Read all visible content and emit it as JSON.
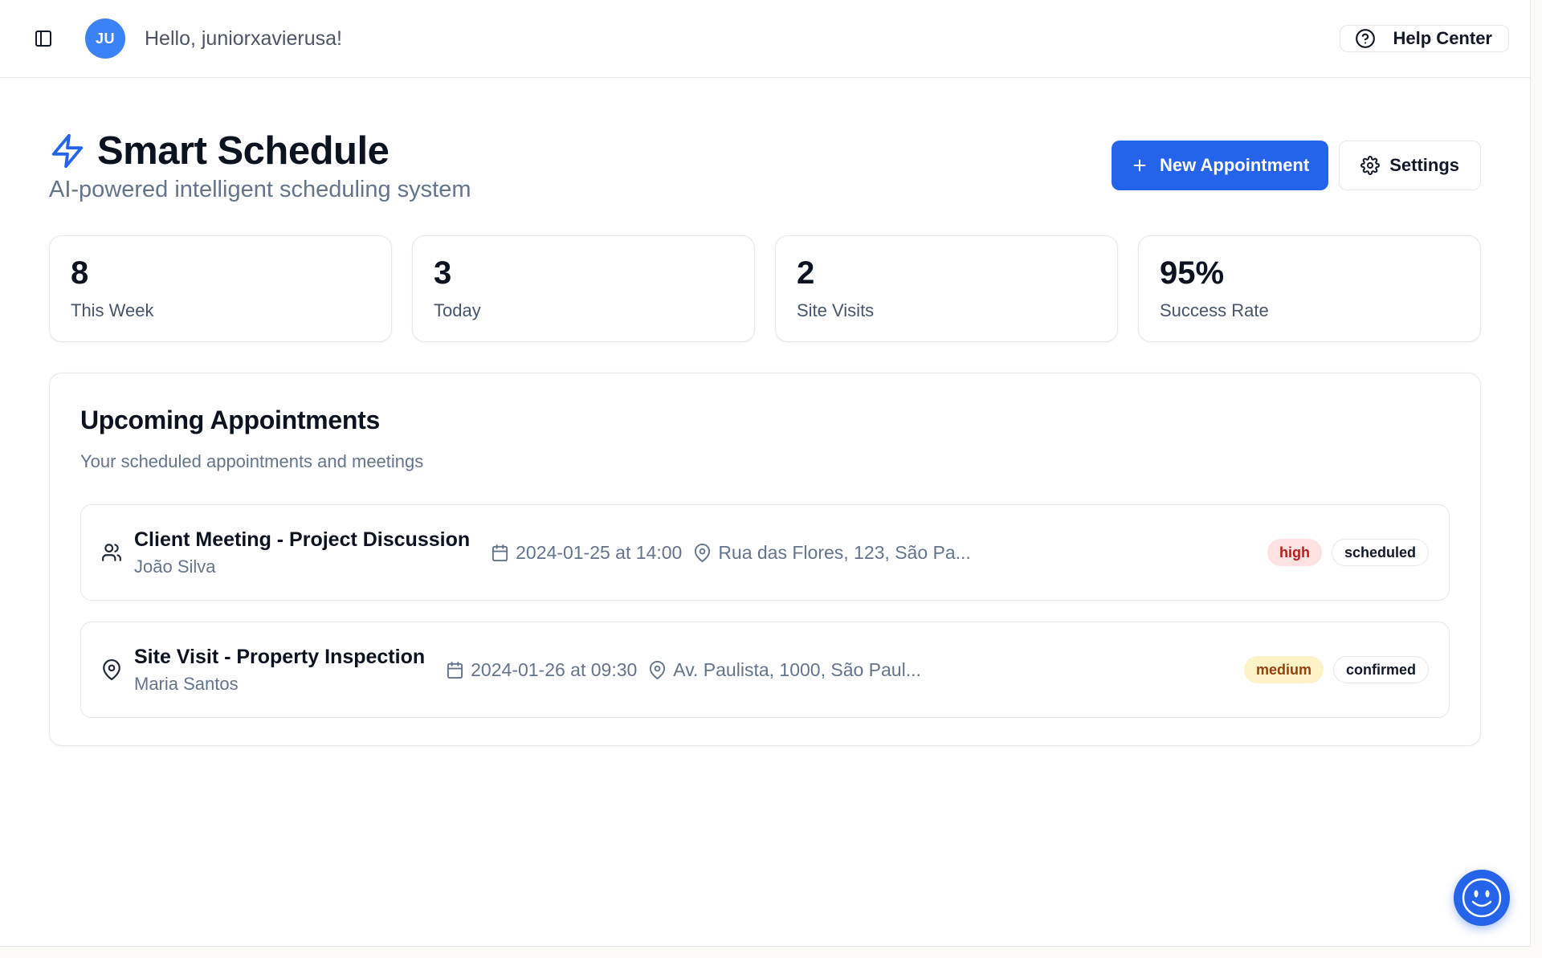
{
  "topbar": {
    "avatar_initials": "JU",
    "greeting": "Hello, juniorxavierusa!",
    "help_label": "Help Center"
  },
  "header": {
    "title": "Smart Schedule",
    "subtitle": "AI-powered intelligent scheduling system",
    "new_appointment_label": "New Appointment",
    "settings_label": "Settings",
    "accent_color": "#2563eb"
  },
  "stats": [
    {
      "value": "8",
      "label": "This Week"
    },
    {
      "value": "3",
      "label": "Today"
    },
    {
      "value": "2",
      "label": "Site Visits"
    },
    {
      "value": "95%",
      "label": "Success Rate"
    }
  ],
  "appointments": {
    "title": "Upcoming Appointments",
    "subtitle": "Your scheduled appointments and meetings",
    "items": [
      {
        "icon": "users-icon",
        "title": "Client Meeting - Project Discussion",
        "person": "João Silva",
        "datetime": "2024-01-25 at 14:00",
        "location": "Rua das Flores, 123, São Pa...",
        "priority": "high",
        "priority_bg": "#fee2e2",
        "priority_fg": "#b91c1c",
        "status": "scheduled"
      },
      {
        "icon": "map-pin-icon",
        "title": "Site Visit - Property Inspection",
        "person": "Maria Santos",
        "datetime": "2024-01-26 at 09:30",
        "location": "Av. Paulista, 1000, São Paul...",
        "priority": "medium",
        "priority_bg": "#fef3c7",
        "priority_fg": "#92400e",
        "status": "confirmed"
      }
    ]
  }
}
